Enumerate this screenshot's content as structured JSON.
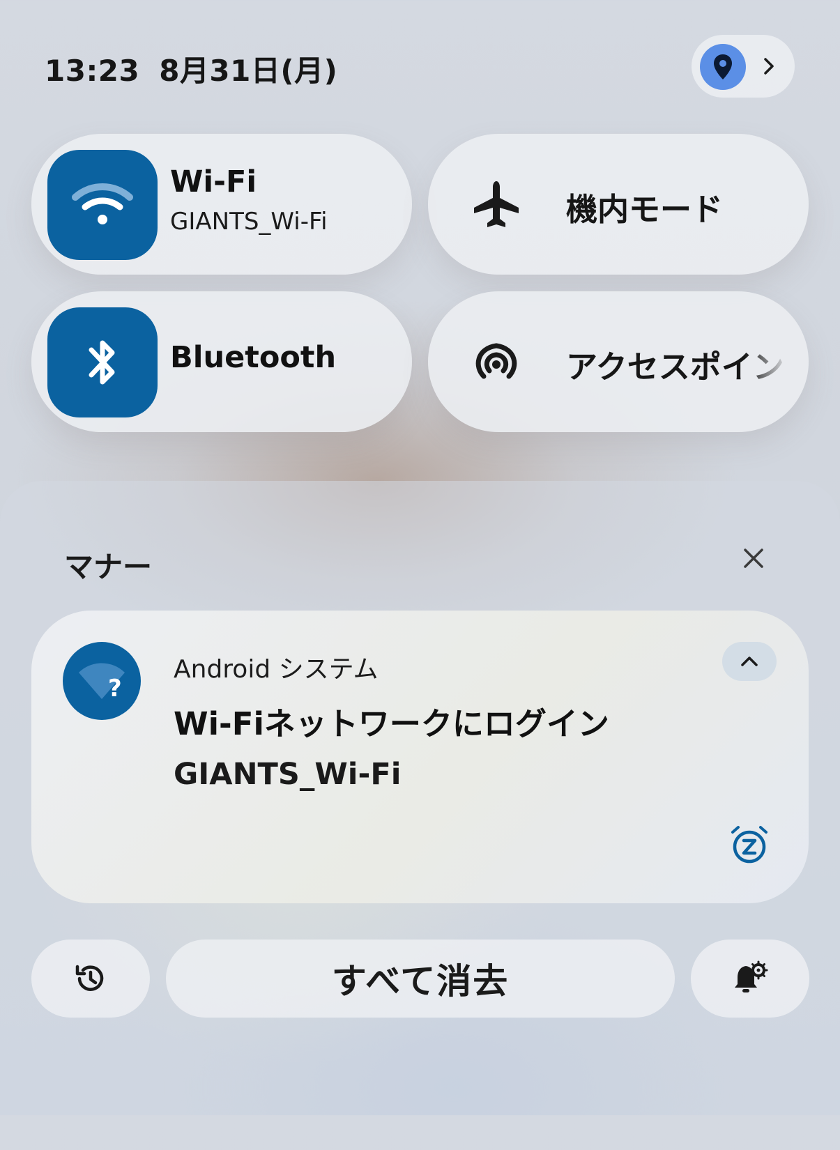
{
  "status": {
    "time": "13:23",
    "date": "8月31日(月)"
  },
  "location_chip": {
    "icon": "location-pin-icon",
    "accent": "#5b8fe6",
    "chevron": "chevron-right-icon"
  },
  "tiles": [
    {
      "id": "wifi",
      "label": "Wi-Fi",
      "sublabel": "GIANTS_Wi-Fi",
      "icon": "wifi-icon",
      "active": true
    },
    {
      "id": "airplane",
      "label": "機内モード",
      "icon": "airplane-icon",
      "active": false
    },
    {
      "id": "bluetooth",
      "label": "Bluetooth",
      "icon": "bluetooth-icon",
      "active": true
    },
    {
      "id": "hotspot",
      "label": "アクセスポイン",
      "icon": "hotspot-icon",
      "active": false
    }
  ],
  "colors": {
    "active_tile": "#0b62a0",
    "tile_bg": "#eceef1"
  },
  "section": {
    "title": "マナー",
    "close_icon": "close-icon"
  },
  "notification": {
    "app_name": "Android システム",
    "title": "Wi-Fiネットワークにログイン",
    "body": "GIANTS_Wi-Fi",
    "avatar_icon": "wifi-question-icon",
    "expand_icon": "chevron-up-icon",
    "snooze_icon": "snooze-icon"
  },
  "actions": {
    "history_icon": "history-icon",
    "clear_all_label": "すべて消去",
    "settings_icon": "notification-settings-icon"
  }
}
